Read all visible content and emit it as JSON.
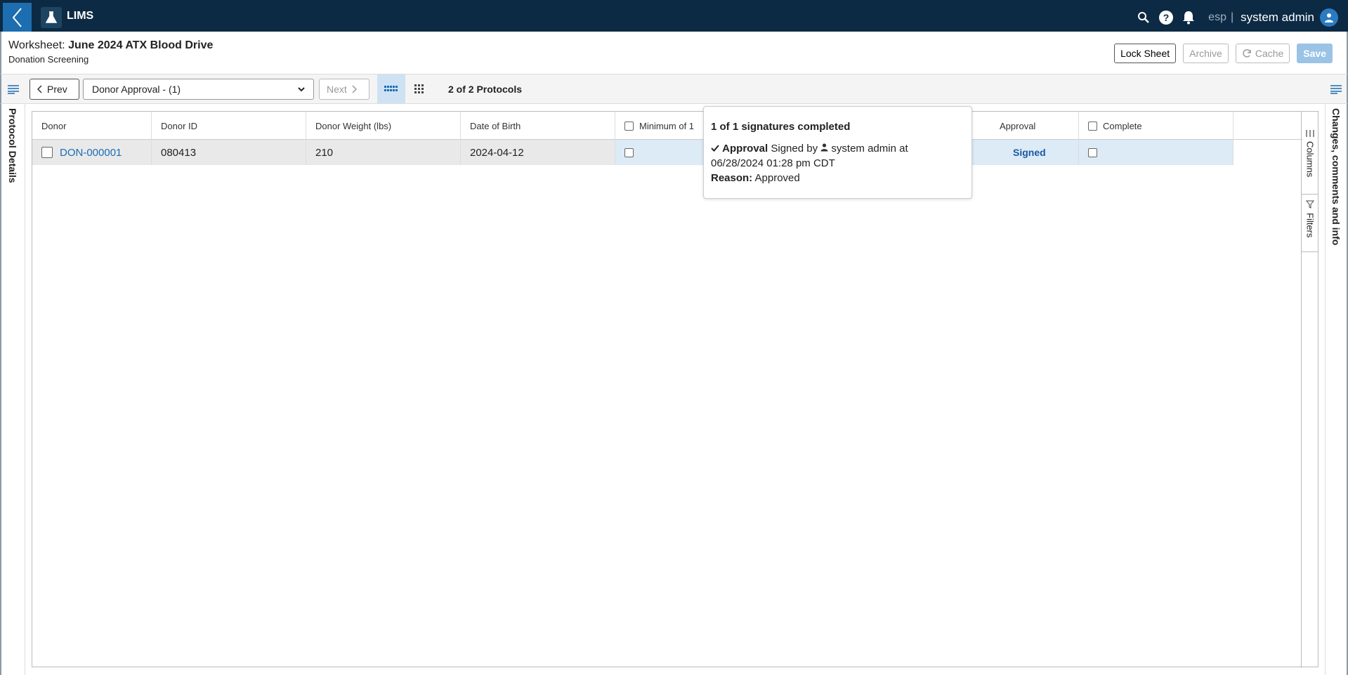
{
  "app": {
    "name": "LIMS"
  },
  "user": {
    "org": "esp",
    "separator": "|",
    "name": "system admin"
  },
  "worksheet": {
    "label": "Worksheet:",
    "name": "June 2024 ATX Blood Drive",
    "subtitle": "Donation Screening"
  },
  "header_buttons": {
    "lock": "Lock Sheet",
    "archive": "Archive",
    "cache": "Cache",
    "save": "Save"
  },
  "toolbar": {
    "prev": "Prev",
    "next": "Next",
    "selected_protocol": "Donor Approval - (1)",
    "protocol_count": "2 of 2 Protocols"
  },
  "side_panels": {
    "left": "Protocol Details",
    "right": "Changes, comments and info"
  },
  "grid": {
    "columns": [
      "Donor",
      "Donor ID",
      "Donor Weight (lbs)",
      "Date of Birth",
      "Minimum of 1",
      "Approval",
      "Complete"
    ],
    "rows": [
      {
        "donor": "DON-000001",
        "donor_id": "080413",
        "weight": "210",
        "dob": "2024-04-12",
        "approval": "Signed"
      }
    ],
    "side_tabs": {
      "columns": "Columns",
      "filters": "Filters"
    }
  },
  "tooltip": {
    "title": "1 of 1 signatures completed",
    "sig_name": "Approval",
    "signed_by": "Signed by",
    "signer": "system admin at",
    "timestamp": "06/28/2024 01:28 pm CDT",
    "reason_label": "Reason:",
    "reason": "Approved"
  },
  "colors": {
    "nav_bg": "#0c2a43",
    "back_btn": "#1d6eb0",
    "link": "#1a6db5",
    "save_btn": "#9bc3e6"
  }
}
